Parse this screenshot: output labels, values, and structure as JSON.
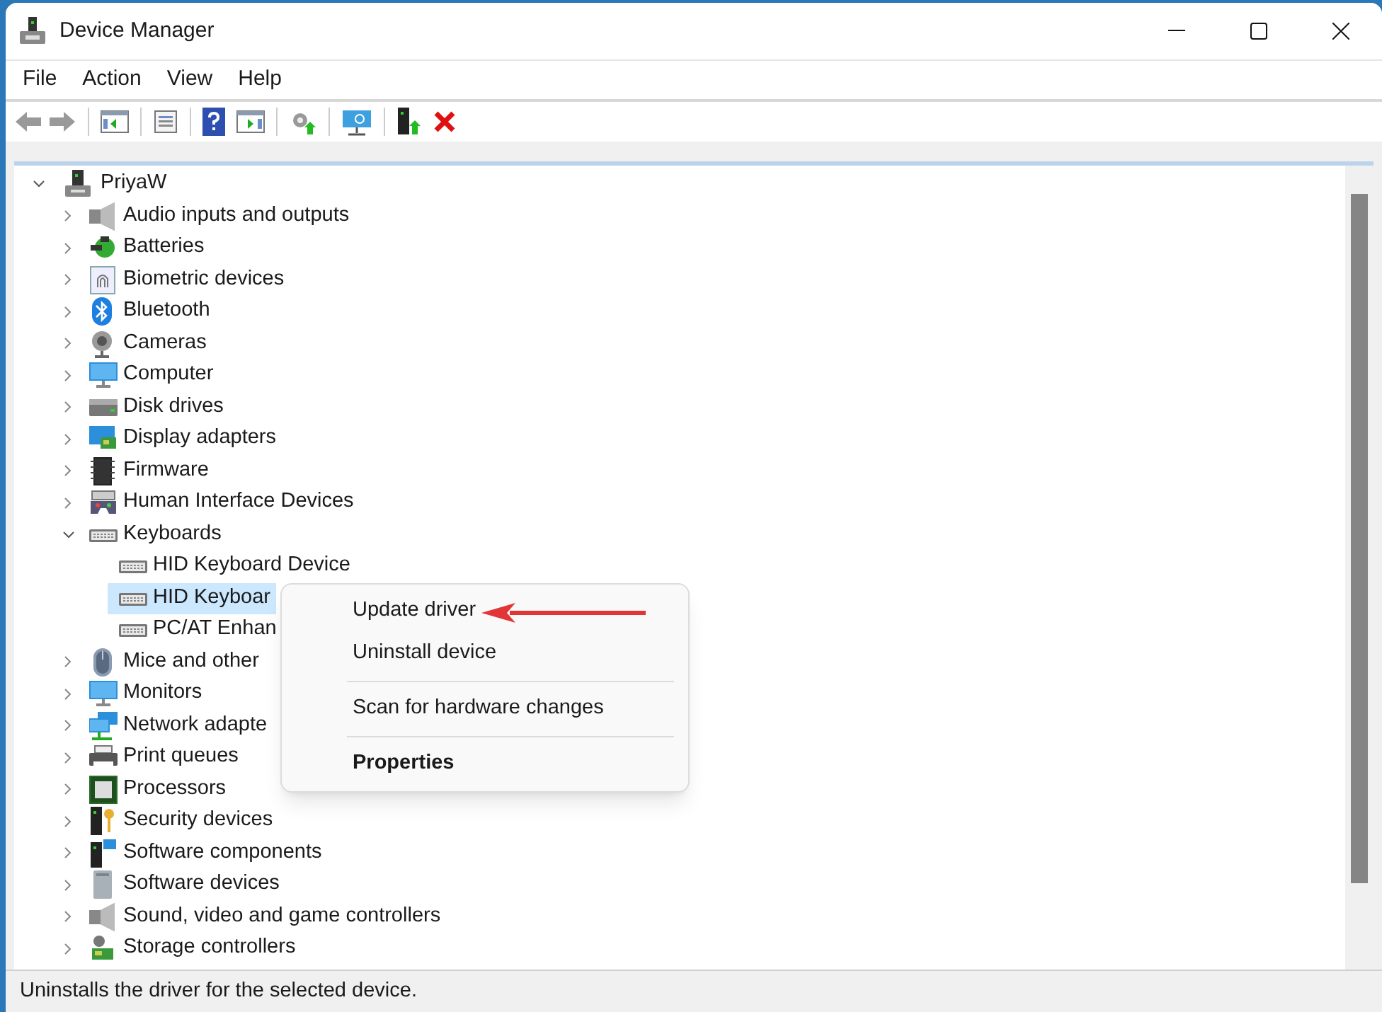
{
  "window": {
    "title": "Device Manager"
  },
  "menu": [
    "File",
    "Action",
    "View",
    "Help"
  ],
  "tree": {
    "label": "PriyaW",
    "expanded": true,
    "children": [
      {
        "label": "Audio inputs and outputs",
        "expanded": false
      },
      {
        "label": "Batteries",
        "expanded": false
      },
      {
        "label": "Biometric devices",
        "expanded": false
      },
      {
        "label": "Bluetooth",
        "expanded": false
      },
      {
        "label": "Cameras",
        "expanded": false
      },
      {
        "label": "Computer",
        "expanded": false
      },
      {
        "label": "Disk drives",
        "expanded": false
      },
      {
        "label": "Display adapters",
        "expanded": false
      },
      {
        "label": "Firmware",
        "expanded": false
      },
      {
        "label": "Human Interface Devices",
        "expanded": false
      },
      {
        "label": "Keyboards",
        "expanded": true,
        "children": [
          {
            "label": "HID Keyboard Device",
            "selected": false
          },
          {
            "label": "HID Keyboar",
            "selected": true
          },
          {
            "label": "PC/AT Enhan",
            "selected": false
          }
        ]
      },
      {
        "label": "Mice and other",
        "expanded": false
      },
      {
        "label": "Monitors",
        "expanded": false
      },
      {
        "label": "Network adapte",
        "expanded": false
      },
      {
        "label": "Print queues",
        "expanded": false
      },
      {
        "label": "Processors",
        "expanded": false
      },
      {
        "label": "Security devices",
        "expanded": false
      },
      {
        "label": "Software components",
        "expanded": false
      },
      {
        "label": "Software devices",
        "expanded": false
      },
      {
        "label": "Sound, video and game controllers",
        "expanded": false
      },
      {
        "label": "Storage controllers",
        "expanded": false
      }
    ]
  },
  "context_menu": [
    {
      "kind": "item",
      "label": "Update driver",
      "default": false
    },
    {
      "kind": "item",
      "label": "Uninstall device",
      "default": false
    },
    {
      "kind": "separator"
    },
    {
      "kind": "item",
      "label": "Scan for hardware changes",
      "default": false
    },
    {
      "kind": "separator"
    },
    {
      "kind": "item",
      "label": "Properties",
      "default": true
    }
  ],
  "status_bar": "Uninstalls the driver for the selected device."
}
